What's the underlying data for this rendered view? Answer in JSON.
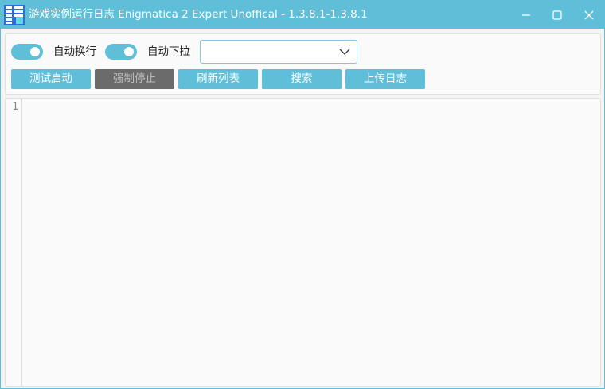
{
  "window": {
    "title": "游戏实例运行日志 Enigmatica 2 Expert Unoffical - 1.3.8.1-1.3.8.1",
    "accent_color": "#5fbfd8"
  },
  "toolbar": {
    "auto_wrap": {
      "label": "自动换行",
      "on": true
    },
    "auto_scroll": {
      "label": "自动下拉",
      "on": true
    },
    "log_select": {
      "value": ""
    },
    "buttons": {
      "test_launch": "测试启动",
      "force_stop": "强制停止",
      "refresh_list": "刷新列表",
      "search": "搜索",
      "upload_log": "上传日志"
    }
  },
  "editor": {
    "line_numbers": [
      "1"
    ],
    "content": ""
  },
  "icons": {
    "app": "app-icon",
    "minimize": "minimize-icon",
    "maximize": "maximize-icon",
    "close": "close-icon",
    "dropdown": "chevron-down-icon"
  }
}
